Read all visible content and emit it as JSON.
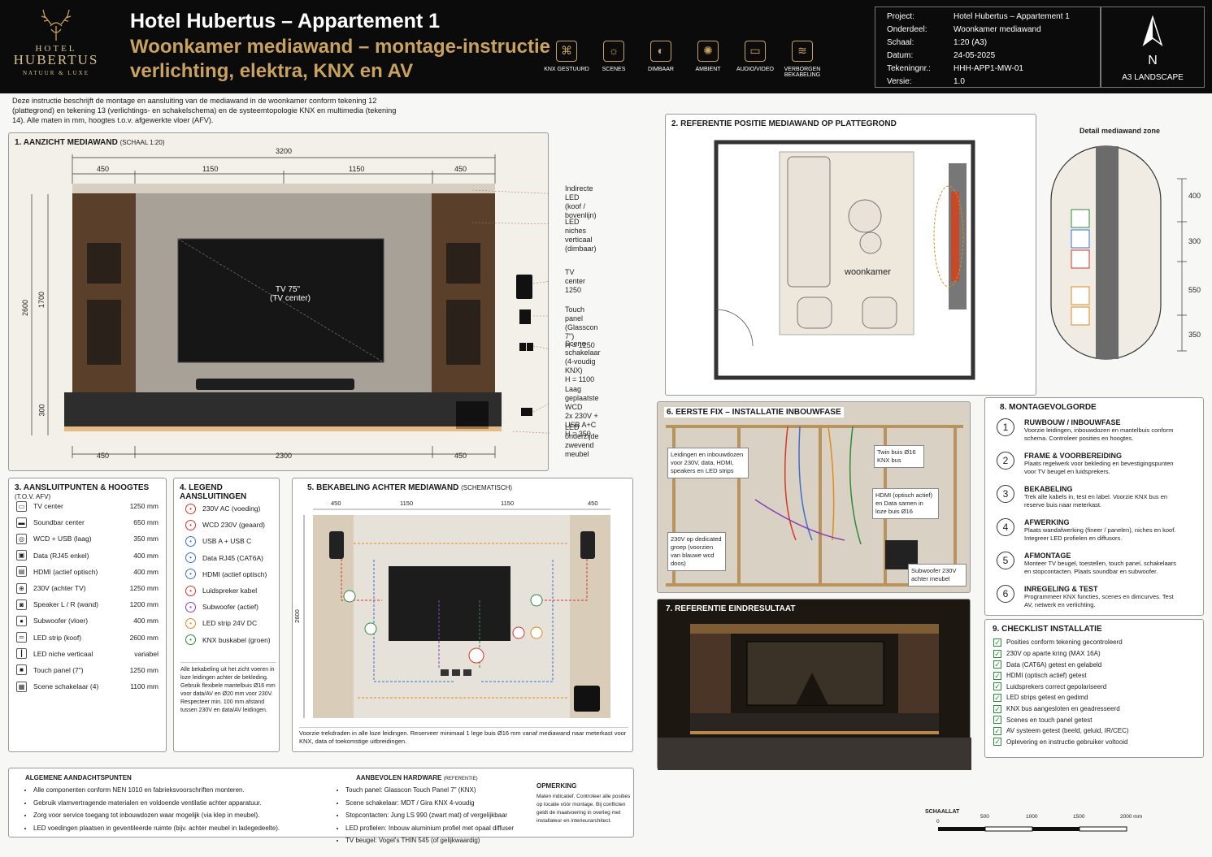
{
  "header": {
    "logo_top": "HOTEL",
    "logo_name": "HUBERTUS",
    "logo_sub": "NATUUR & LUXE",
    "title": "Hotel Hubertus – Appartement 1",
    "subtitle": "Woonkamer mediawand – montage-instructie verlichting, elektra, KNX en AV",
    "features": [
      {
        "icon": "knx-icon",
        "label": "KNX GESTUURD"
      },
      {
        "icon": "scene-icon",
        "label": "SCENES"
      },
      {
        "icon": "dimmer-icon",
        "label": "DIMBAAR"
      },
      {
        "icon": "ambient-icon",
        "label": "AMBIENT"
      },
      {
        "icon": "tv-icon",
        "label": "AUDIO/VIDEO"
      },
      {
        "icon": "cable-icon",
        "label": "VERBORGEN BEKABELING"
      }
    ],
    "meta": [
      {
        "k": "Project:",
        "v": "Hotel Hubertus – Appartement 1"
      },
      {
        "k": "Onderdeel:",
        "v": "Woonkamer mediawand"
      },
      {
        "k": "Schaal:",
        "v": "1:20 (A3)"
      },
      {
        "k": "Datum:",
        "v": "24-05-2025"
      },
      {
        "k": "Tekeningnr.:",
        "v": "HHH-APP1-MW-01"
      },
      {
        "k": "Versie:",
        "v": "1.0"
      }
    ],
    "north": "N",
    "format": "A3 LANDSCAPE"
  },
  "intro": "Deze instructie beschrijft de montage en aansluiting van de mediawand in de woonkamer conform tekening 12 (plattegrond) en tekening 13 (verlichtings- en schakelschema) en de systeemtopologie KNX en multimedia (tekening 14). Alle maten in mm, hoogtes t.o.v. afgewerkte vloer (AFV).",
  "s1": {
    "title": "1. AANZICHT MEDIAWAND",
    "scale": "(SCHAAL 1:20)",
    "total": "3200",
    "top_dims": [
      "450",
      "1150",
      "1150",
      "450"
    ],
    "bottom_dims": [
      "450",
      "2300",
      "450"
    ],
    "h_total": "2600",
    "h_upper": "1700",
    "h_lower": "300",
    "tv": "TV 75\"",
    "tv2": "(TV center)",
    "callouts": [
      {
        "a": "Indirecte LED",
        "b": "(koof / bovenlijn)"
      },
      {
        "a": "LED niches",
        "b": "verticaal (dimbaar)"
      },
      {
        "a": "TV center",
        "b": "1250"
      },
      {
        "a": "Touch panel",
        "b": "(Glasscon 7\")",
        "c": "H = 1250"
      },
      {
        "a": "Scene schakelaar",
        "b": "(4-voudig KNX)",
        "c": "H = 1100"
      },
      {
        "a": "Laag geplaatste WCD",
        "b": "2x 230V + USB A+C",
        "c": "H = 350"
      },
      {
        "a": "LED onderzijde",
        "b": "zwevend meubel"
      }
    ]
  },
  "s2": {
    "title": "2. REFERENTIE POSITIE MEDIAWAND OP PLATTEGROND",
    "room": "woonkamer",
    "detail": "Detail mediawand zone",
    "dims": [
      "400",
      "300",
      "550",
      "350"
    ]
  },
  "s3": {
    "title": "3. AANSLUITPUNTEN & HOOGTES",
    "note": "(T.O.V. AFV)",
    "rows": [
      {
        "n": "TV center",
        "v": "1250 mm"
      },
      {
        "n": "Soundbar center",
        "v": "650 mm"
      },
      {
        "n": "WCD + USB (laag)",
        "v": "350 mm"
      },
      {
        "n": "Data (RJ45 enkel)",
        "v": "400 mm"
      },
      {
        "n": "HDMI (actief optisch)",
        "v": "400 mm"
      },
      {
        "n": "230V (achter TV)",
        "v": "1250 mm"
      },
      {
        "n": "Speaker L / R (wand)",
        "v": "1200 mm"
      },
      {
        "n": "Subwoofer (vloer)",
        "v": "400 mm"
      },
      {
        "n": "LED strip (koof)",
        "v": "2600 mm"
      },
      {
        "n": "LED niche verticaal",
        "v": "variabel"
      },
      {
        "n": "Touch panel (7\")",
        "v": "1250 mm"
      },
      {
        "n": "Scene schakelaar (4)",
        "v": "1100 mm"
      }
    ]
  },
  "s4": {
    "title": "4. LEGEND AANSLUITINGEN",
    "rows": [
      {
        "n": "230V AC (voeding)",
        "c": "#d9342b"
      },
      {
        "n": "WCD 230V (geaard)",
        "c": "#d9342b"
      },
      {
        "n": "USB A + USB C",
        "c": "#3a6fd0"
      },
      {
        "n": "Data RJ45 (CAT6A)",
        "c": "#3a6fd0"
      },
      {
        "n": "HDMI (actief optisch)",
        "c": "#3a6fd0"
      },
      {
        "n": "Luidspreker kabel",
        "c": "#d9342b"
      },
      {
        "n": "Subwoofer (actief)",
        "c": "#8a3fb5"
      },
      {
        "n": "LED strip 24V DC",
        "c": "#e08a1e"
      },
      {
        "n": "KNX buskabel (groen)",
        "c": "#2e8b3e"
      }
    ],
    "note": "Alle bekabeling uit het zicht voeren in loze leidingen achter de bekleding. Gebruik flexibele mantelbuis Ø16 mm voor data/AV en Ø20 mm voor 230V. Respecteer min. 100 mm afstand tussen 230V en data/AV leidingen."
  },
  "s5": {
    "title": "5. BEKABELING ACHTER MEDIAWAND",
    "sub": "(SCHEMATISCH)",
    "dims": [
      "450",
      "1150",
      "1150",
      "450"
    ],
    "h": "2600",
    "note": "Voorzie trekdraden in alle loze leidingen. Reserveer minimaal 1 lege buis Ø16 mm vanaf mediawand naar meterkast voor KNX, data of toekomstige uitbreidingen."
  },
  "s6": {
    "title": "6. EERSTE FIX – INSTALLATIE INBOUWFASE",
    "c1": "Leidingen en inbouwdozen voor 230V, data, HDMI, speakers en LED strips",
    "c2": "Twin buis Ø16 KNX bus",
    "c3": "HDMI (optisch actief) en Data samen in loze buis Ø16",
    "c4": "230V op dedicated groep (voorzien van blauwe wcd doos)",
    "c5": "Subwoofer 230V achter meubel"
  },
  "s7": {
    "title": "7. REFERENTIE EINDRESULTAAT"
  },
  "s8": {
    "title": "8. MONTAGEVOLGORDE",
    "steps": [
      {
        "n": "1",
        "h": "RUWBOUW / INBOUWFASE",
        "d": "Voorzie leidingen, inbouwdozen en mantelbuis conform schema. Controleer posities en hoogtes."
      },
      {
        "n": "2",
        "h": "FRAME & VOORBEREIDING",
        "d": "Plaats regelwerk voor bekleding en bevestigingspunten voor TV beugel en luidsprekers."
      },
      {
        "n": "3",
        "h": "BEKABELING",
        "d": "Trek alle kabels in, test en label. Voorzie KNX bus en reserve buis naar meterkast."
      },
      {
        "n": "4",
        "h": "AFWERKING",
        "d": "Plaats wandafwerking (fineer / panelen), niches en koof. Integreer LED profielen en diffusors."
      },
      {
        "n": "5",
        "h": "AFMONTAGE",
        "d": "Monteer TV beugel, toestellen, touch panel, schakelaars en stopcontacten. Plaats soundbar en subwoofer."
      },
      {
        "n": "6",
        "h": "INREGELING & TEST",
        "d": "Programmeer KNX functies, scenes en dimcurves. Test AV, netwerk en verlichting."
      }
    ]
  },
  "s9": {
    "title": "9. CHECKLIST INSTALLATIE",
    "items": [
      "Posities conform tekening gecontroleerd",
      "230V op aparte kring (MAX 16A)",
      "Data (CAT6A) getest en gelabeld",
      "HDMI (optisch actief) getest",
      "Luidsprekers correct gepolariseerd",
      "LED strips getest en gedimd",
      "KNX bus aangesloten en geadresseerd",
      "Scenes en touch panel getest",
      "AV systeem getest (beeld, geluid, IR/CEC)",
      "Oplevering en instructie gebruiker voltooid"
    ]
  },
  "footer": {
    "h1": "ALGEMENE AANDACHTSPUNTEN",
    "l1": [
      "Alle componenten conform NEN 1010 en fabrieksvoorschriften monteren.",
      "Gebruik vlamvertragende materialen en voldoende ventilatie achter apparatuur.",
      "Zorg voor service toegang tot inbouwdozen waar mogelijk (via klep in meubel).",
      "LED voedingen plaatsen in geventileerde ruimte (bijv. achter meubel in ladegedeelte)."
    ],
    "h2": "AANBEVOLEN HARDWARE",
    "h2s": "(REFERENTIE)",
    "l2": [
      "Touch panel: Glasscon Touch Panel 7\" (KNX)",
      "Scene schakelaar: MDT / Gira KNX 4-voudig",
      "Stopcontacten: Jung LS 990 (zwart mat) of vergelijkbaar",
      "LED profielen: Inbouw aluminium profiel met opaal diffuser",
      "TV beugel: Vogel's THIN 545 (of gelijkwaardig)"
    ],
    "h3": "OPMERKING",
    "t3": "Maten indicatief. Controleer alle posities op locatie vóór montage. Bij conflicten geldt de maatvoering in overleg met installateur en interieurarchitect.",
    "scale_title": "SCHAALLAT",
    "scale": [
      "0",
      "500",
      "1000",
      "1500",
      "2000 mm"
    ]
  }
}
